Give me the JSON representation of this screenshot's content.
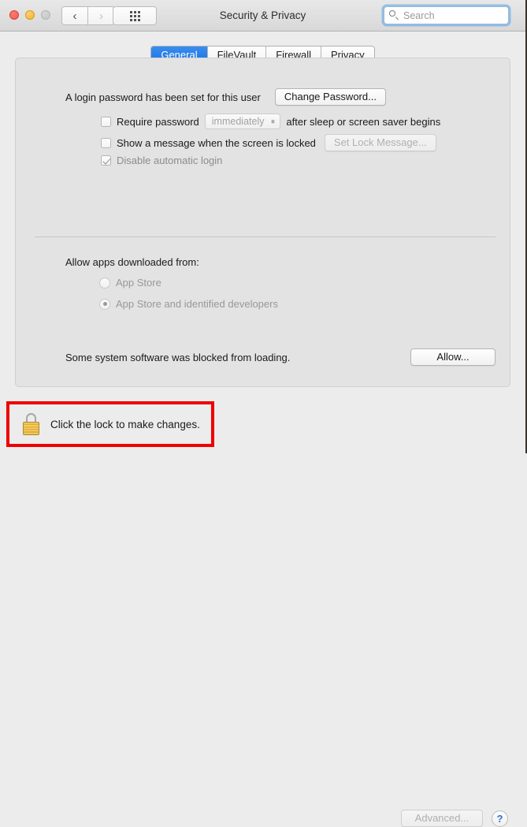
{
  "window": {
    "title": "Security & Privacy",
    "traffic_lights": [
      "close-red",
      "minimize-yellow",
      "zoom-disabled-gray"
    ],
    "nav": {
      "back": "‹",
      "forward": "›"
    },
    "show_all_icon": "grid-dots-icon"
  },
  "search": {
    "placeholder": "Search",
    "value": "",
    "icon": "search-icon",
    "focused": true
  },
  "tabs": [
    {
      "label": "General",
      "active": true
    },
    {
      "label": "FileVault",
      "active": false
    },
    {
      "label": "Firewall",
      "active": false
    },
    {
      "label": "Privacy",
      "active": false
    }
  ],
  "general": {
    "password_status": "A login password has been set for this user",
    "change_password_button": "Change Password...",
    "require_password": {
      "label": "Require password",
      "checked": false,
      "delay_value": "immediately",
      "suffix": "after sleep or screen saver begins"
    },
    "show_message": {
      "label": "Show a message when the screen is locked",
      "checked": false,
      "button": "Set Lock Message...",
      "button_disabled": true
    },
    "disable_auto_login": {
      "label": "Disable automatic login",
      "checked": true,
      "disabled": true
    },
    "allow_apps_title": "Allow apps downloaded from:",
    "allow_apps_options": [
      {
        "label": "App Store",
        "selected": false
      },
      {
        "label": "App Store and identified developers",
        "selected": true
      }
    ],
    "blocked_message": "Some system software was blocked from loading.",
    "allow_button": "Allow..."
  },
  "footer": {
    "lock_icon": "closed-padlock-icon",
    "lock_text": "Click the lock to make changes.",
    "advanced_button": "Advanced...",
    "advanced_disabled": true,
    "help_button": "?"
  },
  "annotation": {
    "highlight_color": "#ee0000",
    "target": "lock-button"
  }
}
